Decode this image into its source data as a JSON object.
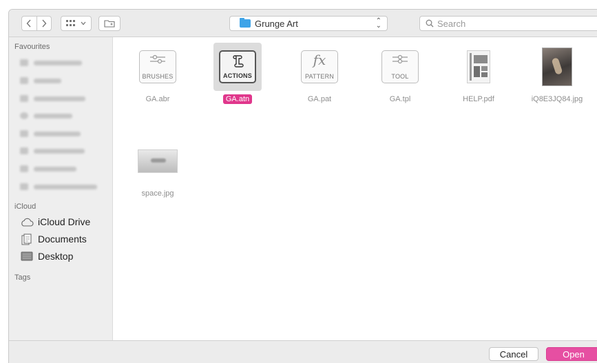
{
  "toolbar": {
    "location": "Grunge Art",
    "search_placeholder": "Search"
  },
  "sidebar": {
    "favourites_header": "Favourites",
    "icloud_header": "iCloud",
    "tags_header": "Tags",
    "icloud_items": [
      {
        "label": "iCloud Drive",
        "icon": "cloud-icon"
      },
      {
        "label": "Documents",
        "icon": "documents-folder-icon"
      },
      {
        "label": "Desktop",
        "icon": "desktop-folder-icon"
      }
    ]
  },
  "files": [
    {
      "name": "GA.abr",
      "icon_label": "BRUSHES",
      "selected": false
    },
    {
      "name": "GA.atn",
      "icon_label": "ACTIONS",
      "selected": true
    },
    {
      "name": "GA.pat",
      "icon_label": "PATTERN",
      "icon_glyph": "fx",
      "selected": false
    },
    {
      "name": "GA.tpl",
      "icon_label": "TOOL",
      "selected": false
    },
    {
      "name": "HELP.pdf",
      "selected": false
    },
    {
      "name": "iQ8E3JQ84.jpg",
      "selected": false
    },
    {
      "name": "space.jpg",
      "selected": false
    }
  ],
  "footer": {
    "cancel_label": "Cancel",
    "open_label": "Open"
  },
  "colors": {
    "accent": "#e64fa2",
    "selection": "#e0378c",
    "folder": "#3fa4e8"
  }
}
